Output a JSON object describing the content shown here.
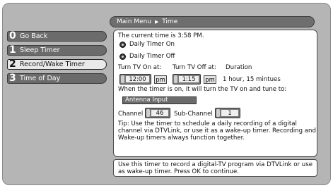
{
  "breadcrumb": {
    "root": "Main Menu",
    "separator": "▶",
    "current": "Time"
  },
  "nav": [
    {
      "num": "0",
      "label": "Go Back"
    },
    {
      "num": "1",
      "label": "Sleep Timer"
    },
    {
      "num": "2",
      "label": "Record/Wake Timer"
    },
    {
      "num": "3",
      "label": "Time of Day"
    }
  ],
  "nav_selected_index": 2,
  "panel": {
    "current_time": "The current time is 3:58 PM.",
    "option_on": "Daily Timer On",
    "option_off": "Daily Timer Off",
    "turn_on_label": "Turn TV On at:",
    "turn_off_label": "Turn TV Off at:",
    "duration_label": "Duration",
    "on_time": "12:00",
    "on_ampm": "pm",
    "off_time": "1:15",
    "off_ampm": "pm",
    "duration_value": "1 hour, 15 mintues",
    "tune_text": "When the timer is on, it will turn the TV on and tune to:",
    "input_source": "Antenna Input",
    "channel_label": "Channel",
    "channel_value": "46",
    "subchannel_label": "Sub-Channel",
    "subchannel_value": "1",
    "tip": "Tip: Use the timer to schedule a daily recording of a digital channel via DTVLink, or use it as a wake-up timer. Recording and Wake-up timers always function together."
  },
  "info_text": "Use this timer to record a digital-TV program via DTVLink or use as wake-up timer. Press OK to continue.",
  "colors": {
    "menu_gray": "#6b6b6b",
    "background": "#b5b5b5",
    "panel": "#ffffff"
  }
}
